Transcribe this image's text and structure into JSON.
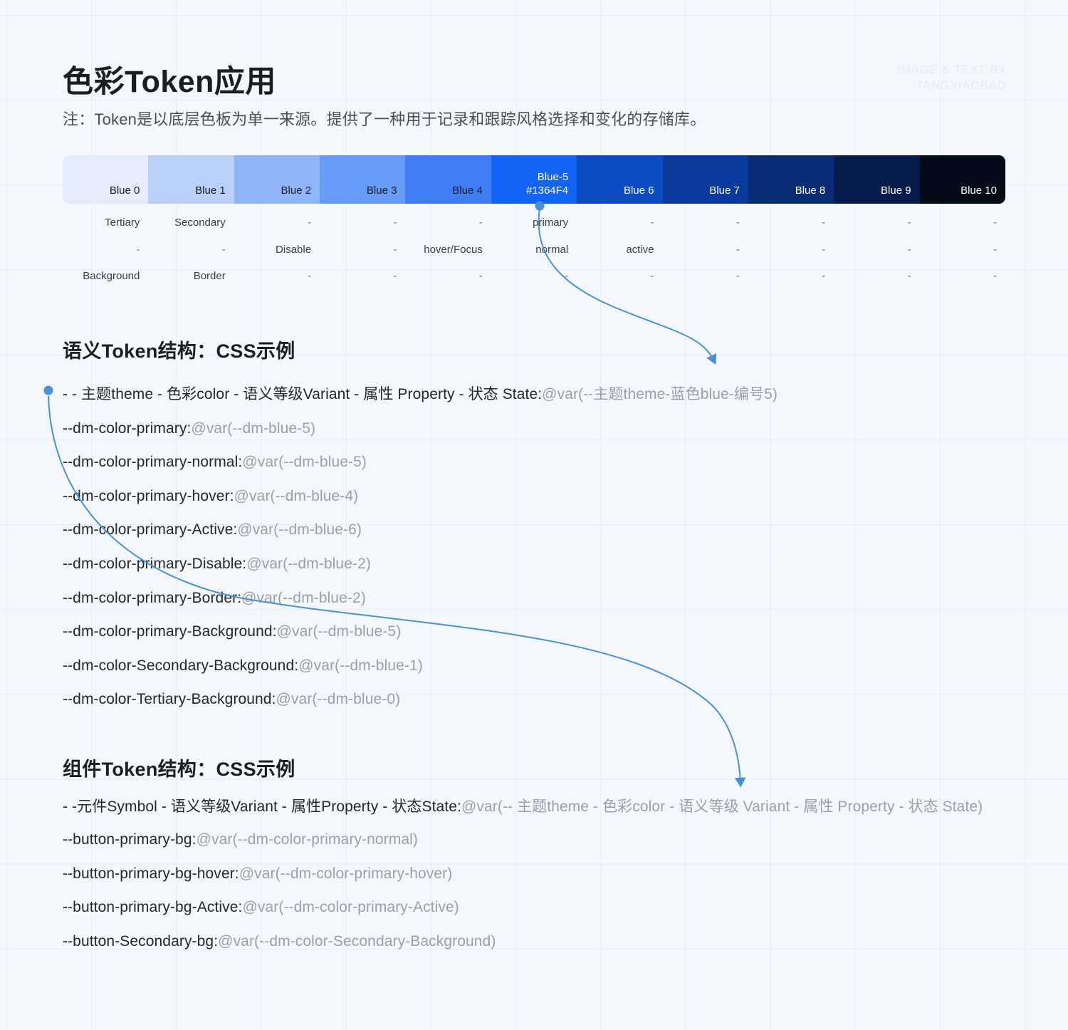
{
  "watermark": {
    "line1": "IMAGE & TEXT BY",
    "line2": "TANGXIAOBAO"
  },
  "header": {
    "title": "色彩Token应用",
    "subtitle": "注：Token是以底层色板为单一来源。提供了一种用于记录和跟踪风格选择和变化的存储库。"
  },
  "palette": {
    "swatches": [
      {
        "label": "Blue 0",
        "hex": "",
        "bg": "#e4ecfb",
        "text": "#1b1d21"
      },
      {
        "label": "Blue 1",
        "hex": "",
        "bg": "#b8d0f8",
        "text": "#1b1d21"
      },
      {
        "label": "Blue 2",
        "hex": "",
        "bg": "#8fb4fa",
        "text": "#1b1d21"
      },
      {
        "label": "Blue 3",
        "hex": "",
        "bg": "#669bf8",
        "text": "#1b1d21"
      },
      {
        "label": "Blue 4",
        "hex": "",
        "bg": "#3f7ef6",
        "text": "#1b1d21"
      },
      {
        "label": "Blue-5",
        "hex": "#1364F4",
        "bg": "#1364f4",
        "text": "#ffffff"
      },
      {
        "label": "Blue 6",
        "hex": "",
        "bg": "#0b4bc4",
        "text": "#ffffff"
      },
      {
        "label": "Blue 7",
        "hex": "",
        "bg": "#0a3a9c",
        "text": "#ffffff"
      },
      {
        "label": "Blue 8",
        "hex": "",
        "bg": "#092c75",
        "text": "#ffffff"
      },
      {
        "label": "Blue 9",
        "hex": "",
        "bg": "#061c4d",
        "text": "#ffffff"
      },
      {
        "label": "Blue 10",
        "hex": "",
        "bg": "#030a18",
        "text": "#ffffff"
      }
    ]
  },
  "token_matrix": {
    "rows": [
      [
        "Tertiary",
        "Secondary",
        "-",
        "-",
        "-",
        "primary",
        "-",
        "-",
        "-",
        "-",
        "-"
      ],
      [
        "-",
        "-",
        "Disable",
        "-",
        "hover/Focus",
        "normal",
        "active",
        "-",
        "-",
        "-",
        "-"
      ],
      [
        "Background",
        "Border",
        "-",
        "-",
        "-",
        "-",
        "-",
        "-",
        "-",
        "-",
        "-"
      ]
    ]
  },
  "semantic_section": {
    "heading": "语义Token结构：CSS示例",
    "lead": {
      "name": "- - 主题theme - 色彩color  - 语义等级Variant - 属性 Property  - 状态 State:",
      "value": "@var(--主题theme-蓝色blue-编号5)"
    },
    "lines": [
      {
        "name": "--dm-color-primary:",
        "value": "@var(--dm-blue-5)"
      },
      {
        "name": "--dm-color-primary-normal:",
        "value": "@var(--dm-blue-5)"
      },
      {
        "name": "--dm-color-primary-hover:",
        "value": "@var(--dm-blue-4)"
      },
      {
        "name": "--dm-color-primary-Active:",
        "value": "@var(--dm-blue-6)"
      },
      {
        "name": "--dm-color-primary-Disable:",
        "value": "@var(--dm-blue-2)"
      },
      {
        "name": "--dm-color-primary-Border:",
        "value": "@var(--dm-blue-2)"
      },
      {
        "name": "--dm-color-primary-Background:",
        "value": "@var(--dm-blue-5)"
      },
      {
        "name": "--dm-color-Secondary-Background:",
        "value": "@var(--dm-blue-1)"
      },
      {
        "name": "--dm-color-Tertiary-Background:",
        "value": "@var(--dm-blue-0)"
      }
    ]
  },
  "component_section": {
    "heading": "组件Token结构：CSS示例",
    "lead": {
      "name": "- -元件Symbol - 语义等级Variant - 属性Property  - 状态State:",
      "value": "@var(-- 主题theme - 色彩color - 语义等级 Variant - 属性 Property  - 状态 State)"
    },
    "lines": [
      {
        "name": "--button-primary-bg:",
        "value": "@var(--dm-color-primary-normal)"
      },
      {
        "name": "--button-primary-bg-hover:",
        "value": "@var(--dm-color-primary-hover)"
      },
      {
        "name": "--button-primary-bg-Active:",
        "value": "@var(--dm-color-primary-Active)"
      },
      {
        "name": "--button-Secondary-bg:",
        "value": "@var(--dm-color-Secondary-Background)"
      }
    ]
  },
  "colors": {
    "accent": "#1364F4",
    "connector": "#5b9bd5",
    "background": "#f4f7fc",
    "text": "#1b1d21",
    "muted": "#9aa0a8"
  }
}
